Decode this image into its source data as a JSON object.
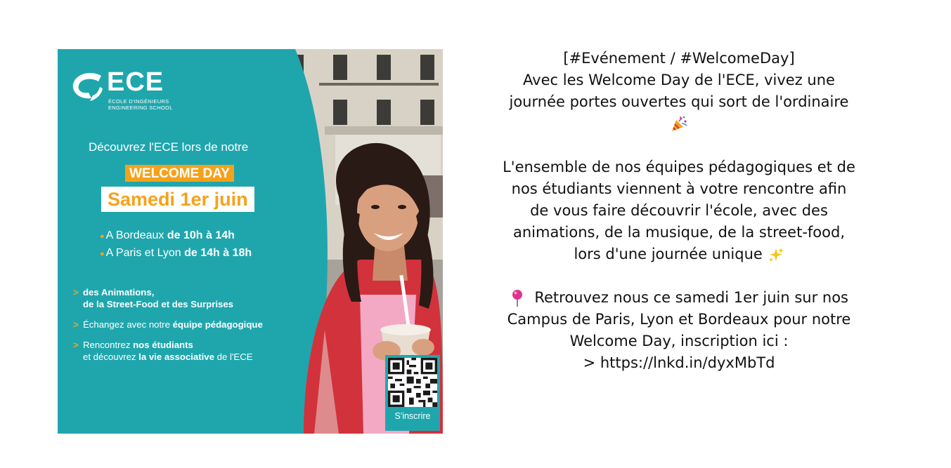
{
  "poster": {
    "logo_name": "ECE",
    "logo_sub": [
      "ÉCOLE D'INGÉNIEURS",
      "ENGINEERING SCHOOL"
    ],
    "intro": "Découvrez l'ECE lors de notre",
    "welcome_tag": "WELCOME DAY",
    "date": "Samedi 1er juin",
    "schedule": [
      {
        "place": "A Bordeaux",
        "hours": "de 10h à 14h"
      },
      {
        "place": "A Paris et Lyon",
        "hours": "de 14h à 18h"
      }
    ],
    "bullets": [
      {
        "bold1": "des Animations,",
        "line2_bold": "de la Street-Food et des Surprises"
      },
      {
        "text": "Échangez avec notre ",
        "bold": "équipe pédagogique"
      },
      {
        "text": "Rencontrez ",
        "bold": "nos étudiants",
        "line2_text": "et découvrez ",
        "line2_bold": "la vie associative",
        "line2_tail": " de l'ECE"
      }
    ],
    "qr_label": "S'inscrire",
    "colors": {
      "teal": "#1fa6ad",
      "orange": "#f4a21c"
    }
  },
  "post": {
    "p1": [
      "[#Evénement / #WelcomeDay]",
      "Avec les Welcome Day de l'ECE, vivez une",
      "journée portes ouvertes qui sort de l'ordinaire"
    ],
    "p1_emoji": "party-popper-icon",
    "p2": [
      "L'ensemble de nos équipes pédagogiques et de",
      "nos étudiants viennent à votre rencontre afin",
      "de vous faire découvrir l'école, avec des",
      "animations, de la musique, de la street-food,",
      "lors d'une journée unique"
    ],
    "p2_emoji": "sparkles-icon",
    "p3": [
      "Retrouvez nous ce samedi 1er juin sur nos",
      "Campus de Paris, Lyon et Bordeaux pour notre",
      "Welcome Day, inscription ici :",
      "> https://lnkd.in/dyxMbTd"
    ],
    "p3_emoji": "round-pushpin-icon"
  }
}
